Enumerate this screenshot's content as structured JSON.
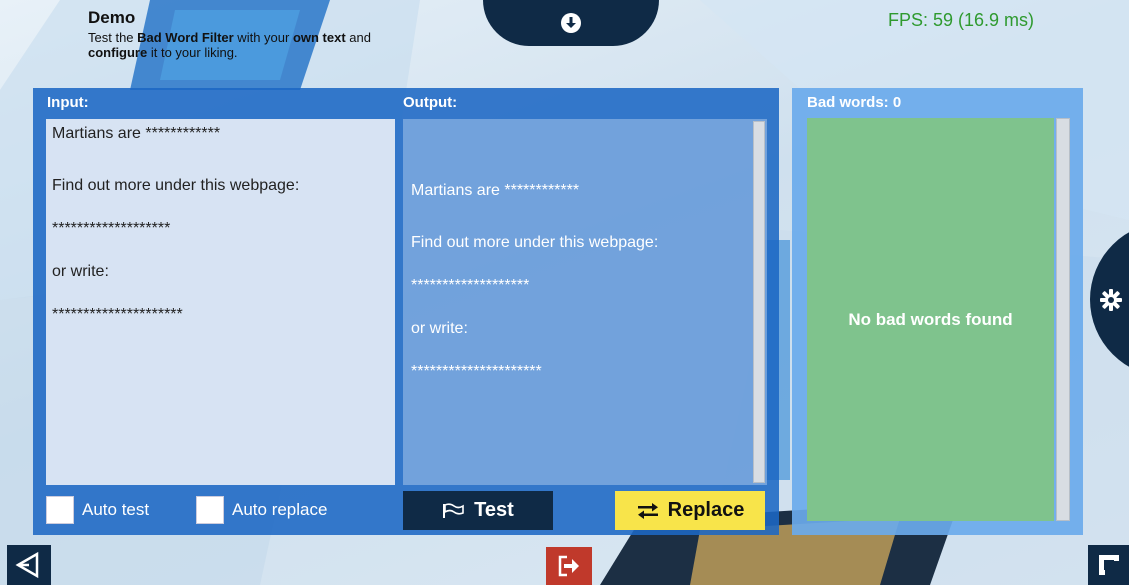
{
  "header": {
    "title": "Demo",
    "desc_prefix": "Test the ",
    "desc_bold1": "Bad Word Filter",
    "desc_mid": " with your ",
    "desc_bold2": "own text",
    "desc_mid2": " and",
    "desc_bold3": "configure",
    "desc_suffix": " it to your liking."
  },
  "fps": "FPS: 59 (16.9 ms)",
  "input": {
    "label": "Input:",
    "lines": [
      "Martians are ************",
      "Find out more under this webpage:",
      "*******************",
      "or write:",
      "*********************"
    ]
  },
  "output": {
    "label": "Output:",
    "lines": [
      "Martians are ************",
      "Find out more under this webpage:",
      "*******************",
      "or write:",
      "*********************"
    ]
  },
  "controls": {
    "auto_test": "Auto test",
    "auto_replace": "Auto replace",
    "test_button": "Test",
    "replace_button": "Replace"
  },
  "bad_words": {
    "label": "Bad words: 0",
    "empty_text": "No bad words found"
  },
  "icons": {
    "download": "download-icon",
    "settings": "gear-icon",
    "unity": "unity-logo-icon",
    "exit": "exit-icon",
    "fullscreen": "fullscreen-icon",
    "flag": "flag-icon",
    "swap": "swap-icon"
  },
  "colors": {
    "panel_blue": "#1c68c4",
    "bad_panel_blue": "#6aaaec",
    "bad_list_green": "#7fc38d",
    "dark_navy": "#0f2a46",
    "replace_yellow": "#f8e44a",
    "fps_green": "#2f9a2f",
    "exit_red": "#c0392b"
  }
}
